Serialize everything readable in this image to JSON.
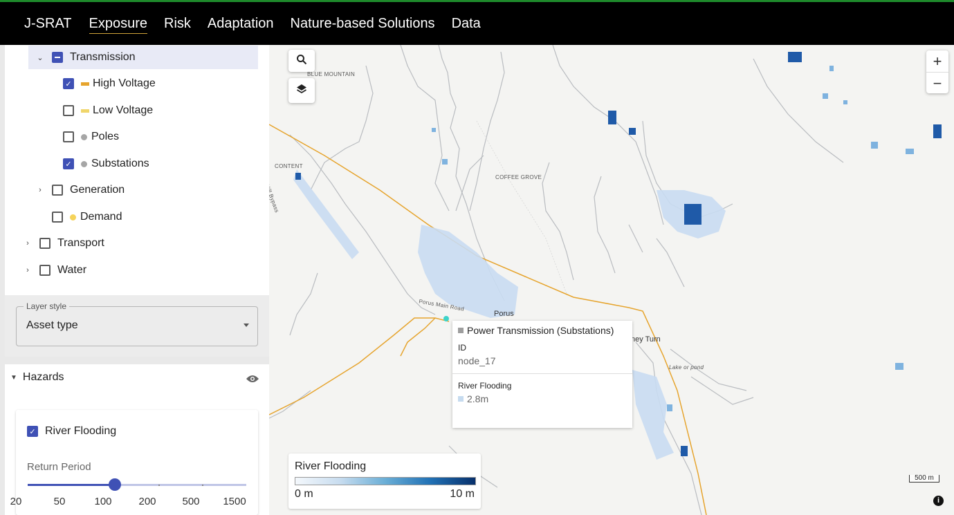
{
  "nav": {
    "brand": "J-SRAT",
    "items": [
      "Exposure",
      "Risk",
      "Adaptation",
      "Nature-based Solutions",
      "Data"
    ],
    "active": "Exposure"
  },
  "layers": {
    "transmission": "Transmission",
    "high_voltage": "High Voltage",
    "low_voltage": "Low Voltage",
    "poles": "Poles",
    "substations": "Substations",
    "generation": "Generation",
    "demand": "Demand",
    "transport": "Transport",
    "water": "Water",
    "colors": {
      "high_voltage": "#e6a42d",
      "low_voltage": "#f0d66b",
      "poles": "#a6a6a6",
      "substations": "#a6a6a6",
      "demand": "#f5d35a"
    }
  },
  "layer_style": {
    "label": "Layer style",
    "value": "Asset type"
  },
  "hazards": {
    "title": "Hazards",
    "river_flooding": "River Flooding",
    "return_period_label": "Return Period",
    "return_periods": [
      "20",
      "50",
      "100",
      "200",
      "500",
      "1500"
    ],
    "selected_return_period": "100"
  },
  "map": {
    "labels": {
      "blue_mountain": "BLUE MOUNTAIN",
      "content": "CONTENT",
      "coffee_grove": "COFFEE GROVE",
      "porus": "Porus",
      "porus_main_road": "Porus Main Road",
      "chey_turn": "ney Turn",
      "lake": "Lake or pond",
      "bypass": "ose Hill Bypass"
    },
    "scale_text": "500 m",
    "accent_color": "#e6a42d",
    "flood_color": "#2171b5"
  },
  "tooltip": {
    "title": "Power Transmission (Substations)",
    "id_label": "ID",
    "id_value": "node_17",
    "hazard_label": "River Flooding",
    "hazard_value": "2.8m"
  },
  "legend": {
    "title": "River Flooding",
    "min": "0 m",
    "max": "10 m"
  }
}
